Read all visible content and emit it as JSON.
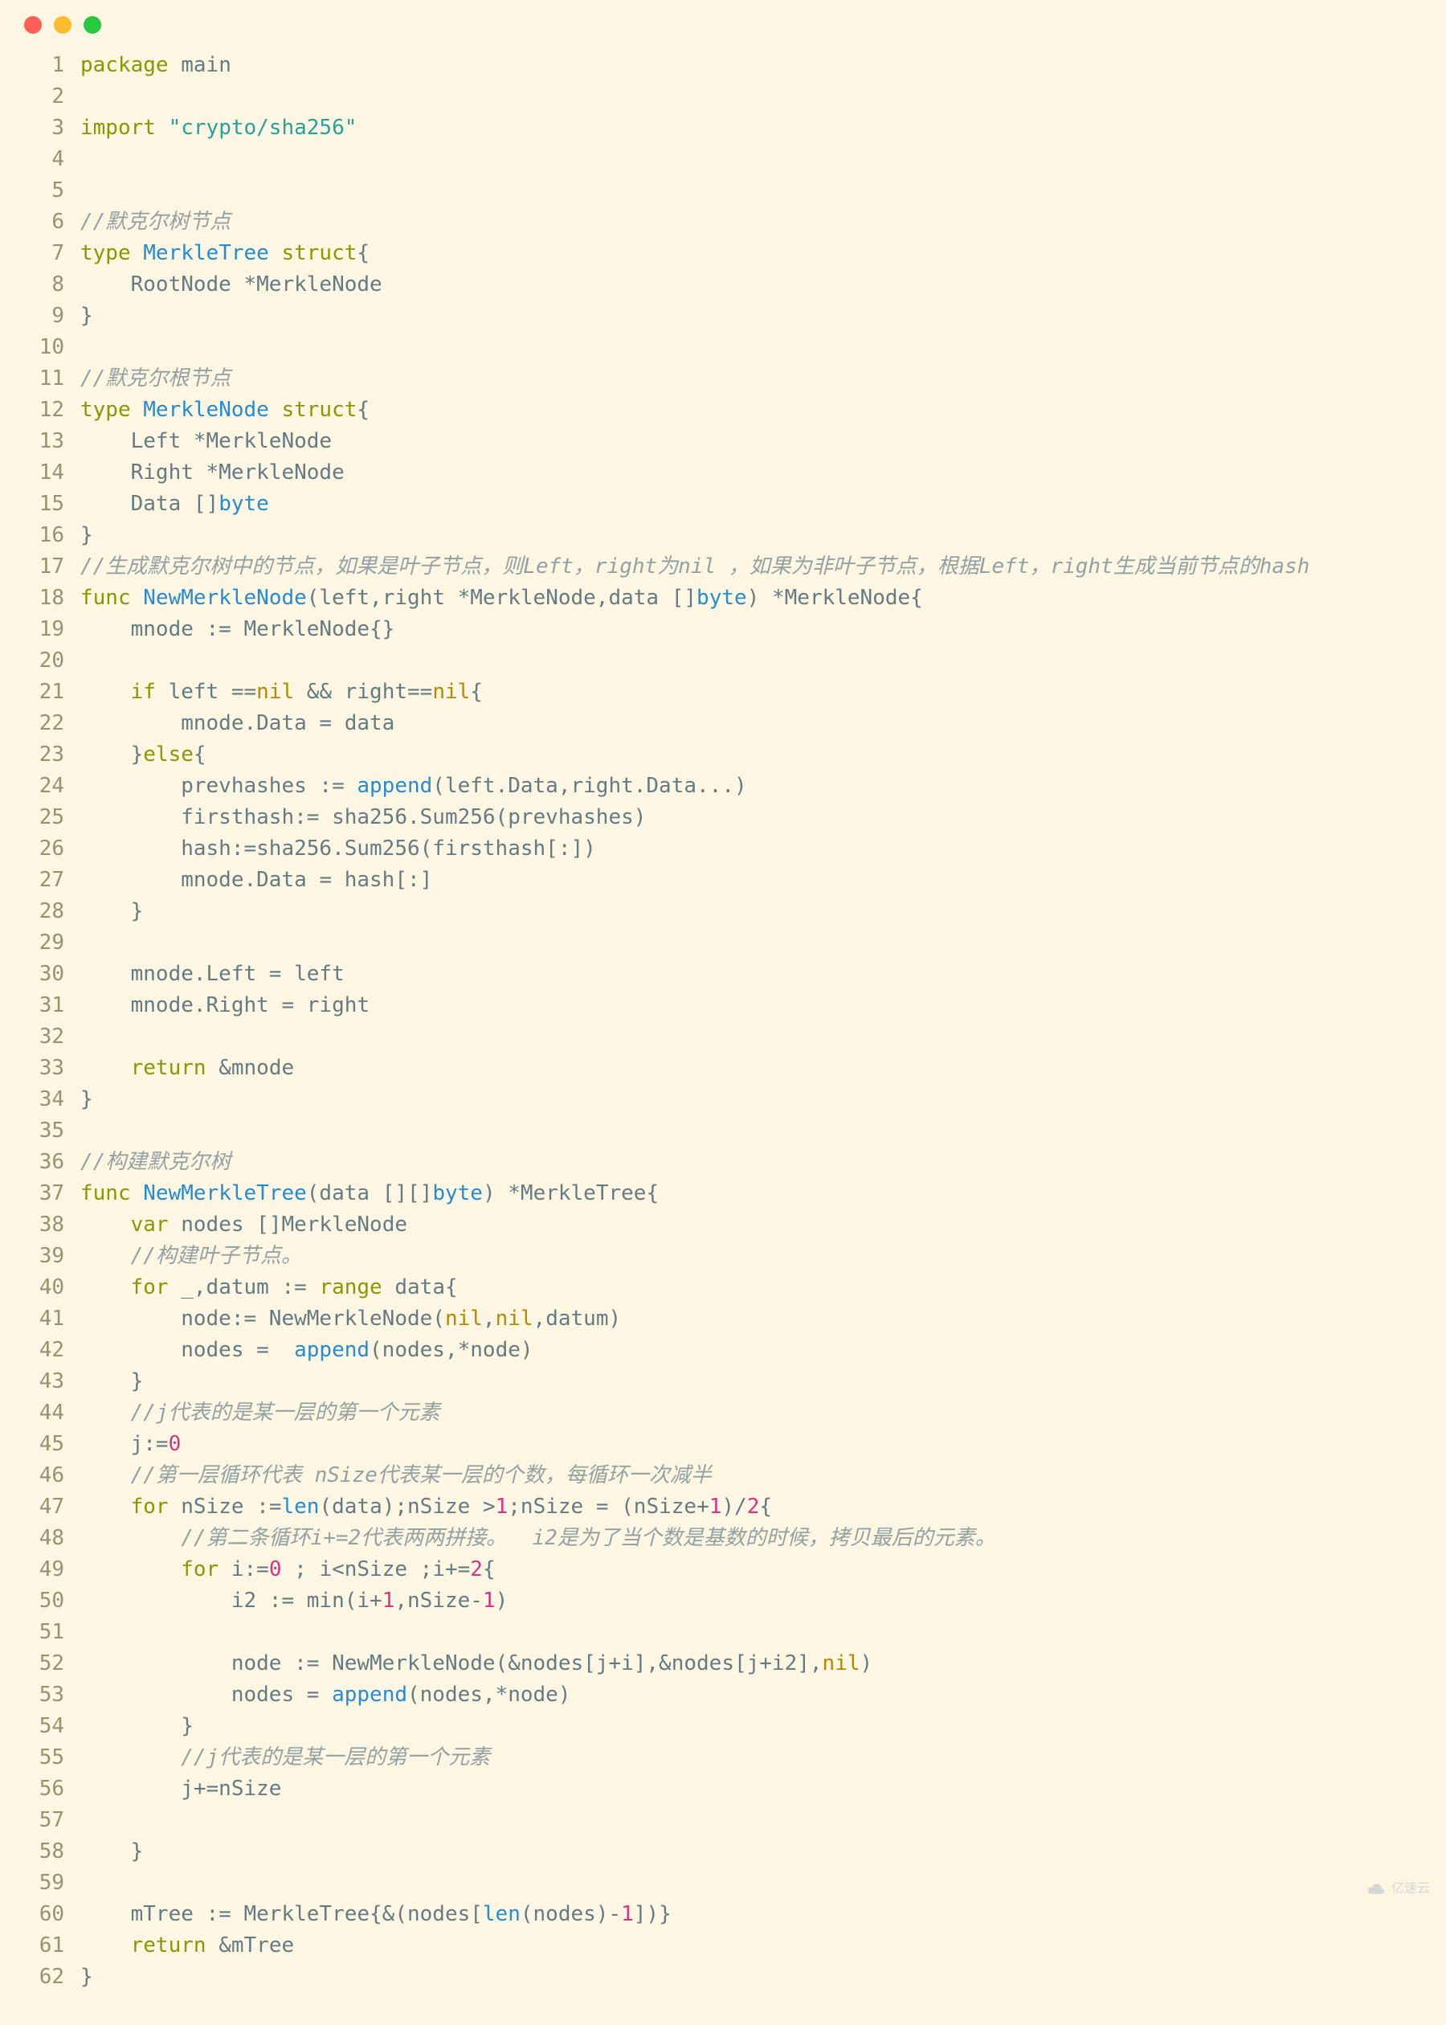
{
  "window": {
    "dots": [
      "red",
      "yellow",
      "green"
    ]
  },
  "watermark": {
    "text": "亿速云"
  },
  "lines": [
    {
      "n": 1,
      "seg": [
        {
          "t": "package ",
          "c": "kw"
        },
        {
          "t": "main",
          "c": "id"
        }
      ]
    },
    {
      "n": 2,
      "seg": []
    },
    {
      "n": 3,
      "seg": [
        {
          "t": "import ",
          "c": "kw"
        },
        {
          "t": "\"crypto/sha256\"",
          "c": "str"
        }
      ]
    },
    {
      "n": 4,
      "seg": []
    },
    {
      "n": 5,
      "seg": []
    },
    {
      "n": 6,
      "seg": [
        {
          "t": "//默克尔树节点",
          "c": "com"
        }
      ]
    },
    {
      "n": 7,
      "seg": [
        {
          "t": "type ",
          "c": "kw"
        },
        {
          "t": "MerkleTree ",
          "c": "typ"
        },
        {
          "t": "struct",
          "c": "kw"
        },
        {
          "t": "{",
          "c": "id"
        }
      ]
    },
    {
      "n": 8,
      "seg": [
        {
          "t": "    RootNode *MerkleNode",
          "c": "id"
        }
      ]
    },
    {
      "n": 9,
      "seg": [
        {
          "t": "}",
          "c": "id"
        }
      ]
    },
    {
      "n": 10,
      "seg": []
    },
    {
      "n": 11,
      "seg": [
        {
          "t": "//默克尔根节点",
          "c": "com"
        }
      ]
    },
    {
      "n": 12,
      "seg": [
        {
          "t": "type ",
          "c": "kw"
        },
        {
          "t": "MerkleNode ",
          "c": "typ"
        },
        {
          "t": "struct",
          "c": "kw"
        },
        {
          "t": "{",
          "c": "id"
        }
      ]
    },
    {
      "n": 13,
      "seg": [
        {
          "t": "    Left *MerkleNode",
          "c": "id"
        }
      ]
    },
    {
      "n": 14,
      "seg": [
        {
          "t": "    Right *MerkleNode",
          "c": "id"
        }
      ]
    },
    {
      "n": 15,
      "seg": [
        {
          "t": "    Data []",
          "c": "id"
        },
        {
          "t": "byte",
          "c": "typ"
        }
      ]
    },
    {
      "n": 16,
      "seg": [
        {
          "t": "}",
          "c": "id"
        }
      ]
    },
    {
      "n": 17,
      "seg": [
        {
          "t": "//生成默克尔树中的节点，如果是叶子节点，则Left，right为nil ，如果为非叶子节点，根据Left，right生成当前节点的hash",
          "c": "com"
        }
      ]
    },
    {
      "n": 18,
      "seg": [
        {
          "t": "func ",
          "c": "kw"
        },
        {
          "t": "NewMerkleNode",
          "c": "fn"
        },
        {
          "t": "(left,right *MerkleNode,data []",
          "c": "id"
        },
        {
          "t": "byte",
          "c": "typ"
        },
        {
          "t": ") *MerkleNode{",
          "c": "id"
        }
      ]
    },
    {
      "n": 19,
      "seg": [
        {
          "t": "    mnode := MerkleNode{}",
          "c": "id"
        }
      ]
    },
    {
      "n": 20,
      "seg": []
    },
    {
      "n": 21,
      "seg": [
        {
          "t": "    ",
          "c": "id"
        },
        {
          "t": "if ",
          "c": "kw"
        },
        {
          "t": "left ==",
          "c": "id"
        },
        {
          "t": "nil",
          "c": "nil"
        },
        {
          "t": " && right==",
          "c": "id"
        },
        {
          "t": "nil",
          "c": "nil"
        },
        {
          "t": "{",
          "c": "id"
        }
      ]
    },
    {
      "n": 22,
      "seg": [
        {
          "t": "        mnode.Data = data",
          "c": "id"
        }
      ]
    },
    {
      "n": 23,
      "seg": [
        {
          "t": "    }",
          "c": "id"
        },
        {
          "t": "else",
          "c": "kw"
        },
        {
          "t": "{",
          "c": "id"
        }
      ]
    },
    {
      "n": 24,
      "seg": [
        {
          "t": "        prevhashes := ",
          "c": "id"
        },
        {
          "t": "append",
          "c": "bi"
        },
        {
          "t": "(left.Data,right.Data...)",
          "c": "id"
        }
      ]
    },
    {
      "n": 25,
      "seg": [
        {
          "t": "        firsthash:= sha256.Sum256(prevhashes)",
          "c": "id"
        }
      ]
    },
    {
      "n": 26,
      "seg": [
        {
          "t": "        hash:=sha256.Sum256(firsthash[:])",
          "c": "id"
        }
      ]
    },
    {
      "n": 27,
      "seg": [
        {
          "t": "        mnode.Data = hash[:]",
          "c": "id"
        }
      ]
    },
    {
      "n": 28,
      "seg": [
        {
          "t": "    }",
          "c": "id"
        }
      ]
    },
    {
      "n": 29,
      "seg": []
    },
    {
      "n": 30,
      "seg": [
        {
          "t": "    mnode.Left = left",
          "c": "id"
        }
      ]
    },
    {
      "n": 31,
      "seg": [
        {
          "t": "    mnode.Right = right",
          "c": "id"
        }
      ]
    },
    {
      "n": 32,
      "seg": []
    },
    {
      "n": 33,
      "seg": [
        {
          "t": "    ",
          "c": "id"
        },
        {
          "t": "return ",
          "c": "kw"
        },
        {
          "t": "&mnode",
          "c": "id"
        }
      ]
    },
    {
      "n": 34,
      "seg": [
        {
          "t": "}",
          "c": "id"
        }
      ]
    },
    {
      "n": 35,
      "seg": []
    },
    {
      "n": 36,
      "seg": [
        {
          "t": "//构建默克尔树",
          "c": "com"
        }
      ]
    },
    {
      "n": 37,
      "seg": [
        {
          "t": "func ",
          "c": "kw"
        },
        {
          "t": "NewMerkleTree",
          "c": "fn"
        },
        {
          "t": "(data [][]",
          "c": "id"
        },
        {
          "t": "byte",
          "c": "typ"
        },
        {
          "t": ") *MerkleTree{",
          "c": "id"
        }
      ]
    },
    {
      "n": 38,
      "seg": [
        {
          "t": "    ",
          "c": "id"
        },
        {
          "t": "var ",
          "c": "kw"
        },
        {
          "t": "nodes []MerkleNode",
          "c": "id"
        }
      ]
    },
    {
      "n": 39,
      "seg": [
        {
          "t": "    ",
          "c": "id"
        },
        {
          "t": "//构建叶子节点。",
          "c": "com"
        }
      ]
    },
    {
      "n": 40,
      "seg": [
        {
          "t": "    ",
          "c": "id"
        },
        {
          "t": "for ",
          "c": "kw"
        },
        {
          "t": "_,datum := ",
          "c": "id"
        },
        {
          "t": "range ",
          "c": "kw"
        },
        {
          "t": "data{",
          "c": "id"
        }
      ]
    },
    {
      "n": 41,
      "seg": [
        {
          "t": "        node:= NewMerkleNode(",
          "c": "id"
        },
        {
          "t": "nil",
          "c": "nil"
        },
        {
          "t": ",",
          "c": "id"
        },
        {
          "t": "nil",
          "c": "nil"
        },
        {
          "t": ",datum)",
          "c": "id"
        }
      ]
    },
    {
      "n": 42,
      "seg": [
        {
          "t": "        nodes =  ",
          "c": "id"
        },
        {
          "t": "append",
          "c": "bi"
        },
        {
          "t": "(nodes,*node)",
          "c": "id"
        }
      ]
    },
    {
      "n": 43,
      "seg": [
        {
          "t": "    }",
          "c": "id"
        }
      ]
    },
    {
      "n": 44,
      "seg": [
        {
          "t": "    ",
          "c": "id"
        },
        {
          "t": "//j代表的是某一层的第一个元素",
          "c": "com"
        }
      ]
    },
    {
      "n": 45,
      "seg": [
        {
          "t": "    j:=",
          "c": "id"
        },
        {
          "t": "0",
          "c": "num"
        }
      ]
    },
    {
      "n": 46,
      "seg": [
        {
          "t": "    ",
          "c": "id"
        },
        {
          "t": "//第一层循环代表 nSize代表某一层的个数，每循环一次减半",
          "c": "com"
        }
      ]
    },
    {
      "n": 47,
      "seg": [
        {
          "t": "    ",
          "c": "id"
        },
        {
          "t": "for ",
          "c": "kw"
        },
        {
          "t": "nSize :=",
          "c": "id"
        },
        {
          "t": "len",
          "c": "bi"
        },
        {
          "t": "(data);nSize >",
          "c": "id"
        },
        {
          "t": "1",
          "c": "num"
        },
        {
          "t": ";nSize = (nSize+",
          "c": "id"
        },
        {
          "t": "1",
          "c": "num"
        },
        {
          "t": ")/",
          "c": "id"
        },
        {
          "t": "2",
          "c": "num"
        },
        {
          "t": "{",
          "c": "id"
        }
      ]
    },
    {
      "n": 48,
      "seg": [
        {
          "t": "        ",
          "c": "id"
        },
        {
          "t": "//第二条循环i+=2代表两两拼接。  i2是为了当个数是基数的时候，拷贝最后的元素。",
          "c": "com"
        }
      ]
    },
    {
      "n": 49,
      "seg": [
        {
          "t": "        ",
          "c": "id"
        },
        {
          "t": "for ",
          "c": "kw"
        },
        {
          "t": "i:=",
          "c": "id"
        },
        {
          "t": "0",
          "c": "num"
        },
        {
          "t": " ; i<nSize ;i+=",
          "c": "id"
        },
        {
          "t": "2",
          "c": "num"
        },
        {
          "t": "{",
          "c": "id"
        }
      ]
    },
    {
      "n": 50,
      "seg": [
        {
          "t": "            i2 := min(i+",
          "c": "id"
        },
        {
          "t": "1",
          "c": "num"
        },
        {
          "t": ",nSize-",
          "c": "id"
        },
        {
          "t": "1",
          "c": "num"
        },
        {
          "t": ")",
          "c": "id"
        }
      ]
    },
    {
      "n": 51,
      "seg": []
    },
    {
      "n": 52,
      "seg": [
        {
          "t": "            node := NewMerkleNode(&nodes[j+i],&nodes[j+i2],",
          "c": "id"
        },
        {
          "t": "nil",
          "c": "nil"
        },
        {
          "t": ")",
          "c": "id"
        }
      ]
    },
    {
      "n": 53,
      "seg": [
        {
          "t": "            nodes = ",
          "c": "id"
        },
        {
          "t": "append",
          "c": "bi"
        },
        {
          "t": "(nodes,*node)",
          "c": "id"
        }
      ]
    },
    {
      "n": 54,
      "seg": [
        {
          "t": "        }",
          "c": "id"
        }
      ]
    },
    {
      "n": 55,
      "seg": [
        {
          "t": "        ",
          "c": "id"
        },
        {
          "t": "//j代表的是某一层的第一个元素",
          "c": "com"
        }
      ]
    },
    {
      "n": 56,
      "seg": [
        {
          "t": "        j+=nSize",
          "c": "id"
        }
      ]
    },
    {
      "n": 57,
      "seg": []
    },
    {
      "n": 58,
      "seg": [
        {
          "t": "    }",
          "c": "id"
        }
      ]
    },
    {
      "n": 59,
      "seg": []
    },
    {
      "n": 60,
      "seg": [
        {
          "t": "    mTree := MerkleTree{&(nodes[",
          "c": "id"
        },
        {
          "t": "len",
          "c": "bi"
        },
        {
          "t": "(nodes)-",
          "c": "id"
        },
        {
          "t": "1",
          "c": "num"
        },
        {
          "t": "])}",
          "c": "id"
        }
      ]
    },
    {
      "n": 61,
      "seg": [
        {
          "t": "    ",
          "c": "id"
        },
        {
          "t": "return ",
          "c": "kw"
        },
        {
          "t": "&mTree",
          "c": "id"
        }
      ]
    },
    {
      "n": 62,
      "seg": [
        {
          "t": "}",
          "c": "id"
        }
      ]
    }
  ]
}
